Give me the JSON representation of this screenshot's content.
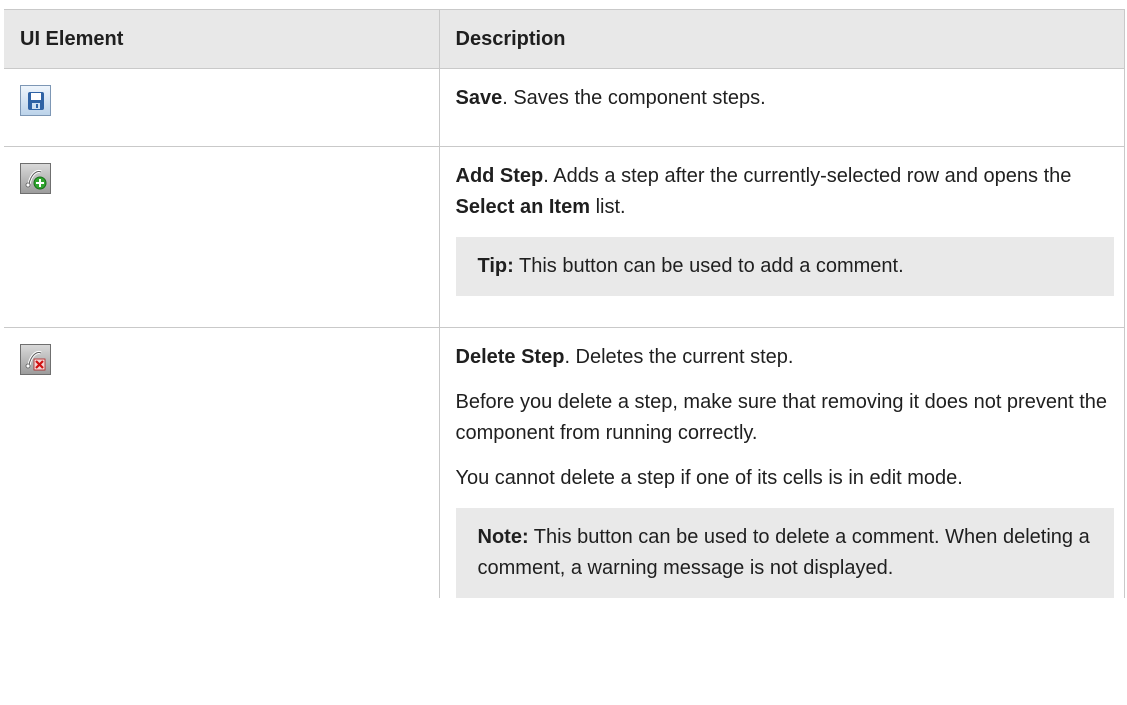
{
  "table": {
    "headers": {
      "col1": "UI Element",
      "col2": "Description"
    },
    "rows": [
      {
        "icon": "save-icon",
        "title": "Save",
        "desc": ". Saves the component steps."
      },
      {
        "icon": "add-step-icon",
        "title": "Add Step",
        "desc_a": ". Adds a step after the currently-selected row and opens the ",
        "desc_bold": "Select an Item",
        "desc_b": " list.",
        "tip_label": "Tip:",
        "tip_text": " This button can be used to add a comment."
      },
      {
        "icon": "delete-step-icon",
        "title": "Delete Step",
        "desc": ". Deletes the current step.",
        "p2": "Before you delete a step, make sure that removing it does not prevent the component from running correctly.",
        "p3": "You cannot delete a step if one of its cells is in edit mode.",
        "note_label": "Note:",
        "note_text": " This button can be used to delete a comment. When deleting a comment, a warning message is not displayed."
      }
    ]
  },
  "colors": {
    "header_bg": "#e8e8e8",
    "note_bg": "#e9e9e9",
    "border": "#c9c9c9"
  }
}
